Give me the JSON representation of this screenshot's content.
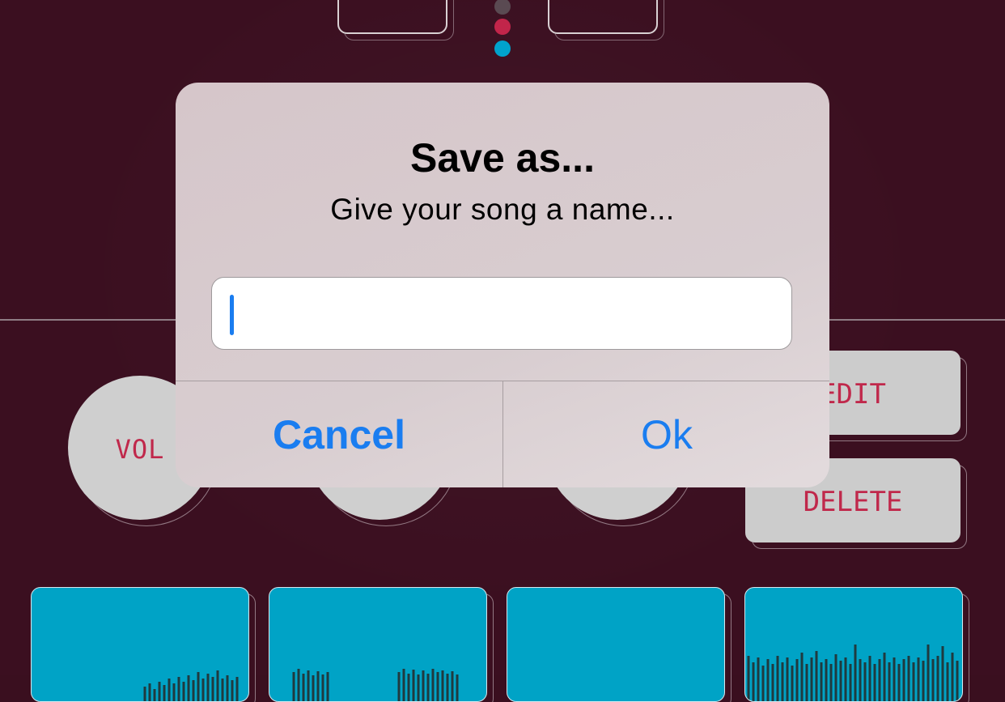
{
  "app": {
    "knobs": [
      {
        "label": "VOL"
      },
      {
        "label": ""
      },
      {
        "label": ""
      }
    ],
    "side_buttons": {
      "edit_label": "EDIT",
      "delete_label": "DELETE"
    },
    "colors": {
      "background": "#3b0f20",
      "accent": "#c0284b",
      "cyan": "#00a3c6",
      "dot_inactive": "#5a4a52"
    }
  },
  "dialog": {
    "title": "Save as...",
    "message": "Give your song a name...",
    "input_value": "",
    "cancel_label": "Cancel",
    "ok_label": "Ok",
    "button_color": "#1a7df0"
  }
}
